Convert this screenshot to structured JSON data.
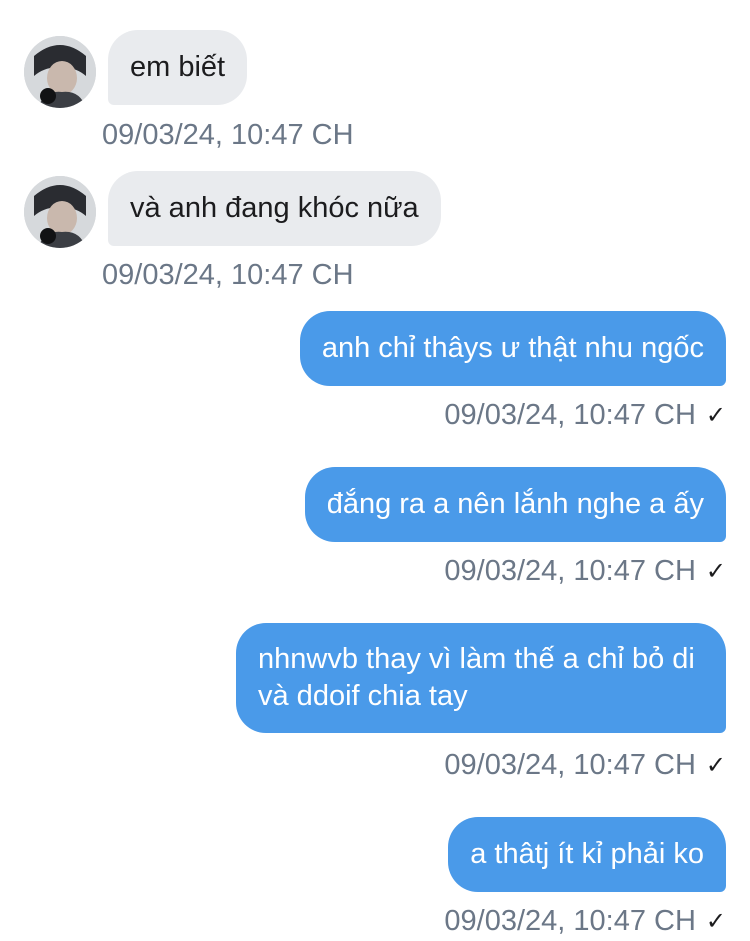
{
  "colors": {
    "incoming_bubble": "#e9ebee",
    "outgoing_bubble": "#4a9ae9",
    "timestamp": "#6b7787"
  },
  "messages": [
    {
      "direction": "incoming",
      "text": "em biết",
      "time": "09/03/24, 10:47 CH",
      "avatar": "user-avatar"
    },
    {
      "direction": "incoming",
      "text": "và anh đang khóc nữa",
      "time": "09/03/24, 10:47 CH",
      "avatar": "user-avatar"
    },
    {
      "direction": "outgoing",
      "text": "anh chỉ thâys ư thật nhu ngốc",
      "time": "09/03/24, 10:47 CH",
      "status_icon": "check-icon",
      "status_glyph": "✓"
    },
    {
      "direction": "outgoing",
      "text": "đắng ra a nên lắnh nghe a ấy",
      "time": "09/03/24, 10:47 CH",
      "status_icon": "check-icon",
      "status_glyph": "✓"
    },
    {
      "direction": "outgoing",
      "text": "nhnwvb thay vì làm thế a chỉ bỏ di và ddoif chia tay",
      "time": "09/03/24, 10:47 CH",
      "status_icon": "check-icon",
      "status_glyph": "✓"
    },
    {
      "direction": "outgoing",
      "text": "a thâtj ít kỉ phải ko",
      "time": "09/03/24, 10:47 CH",
      "status_icon": "check-icon",
      "status_glyph": "✓"
    }
  ]
}
